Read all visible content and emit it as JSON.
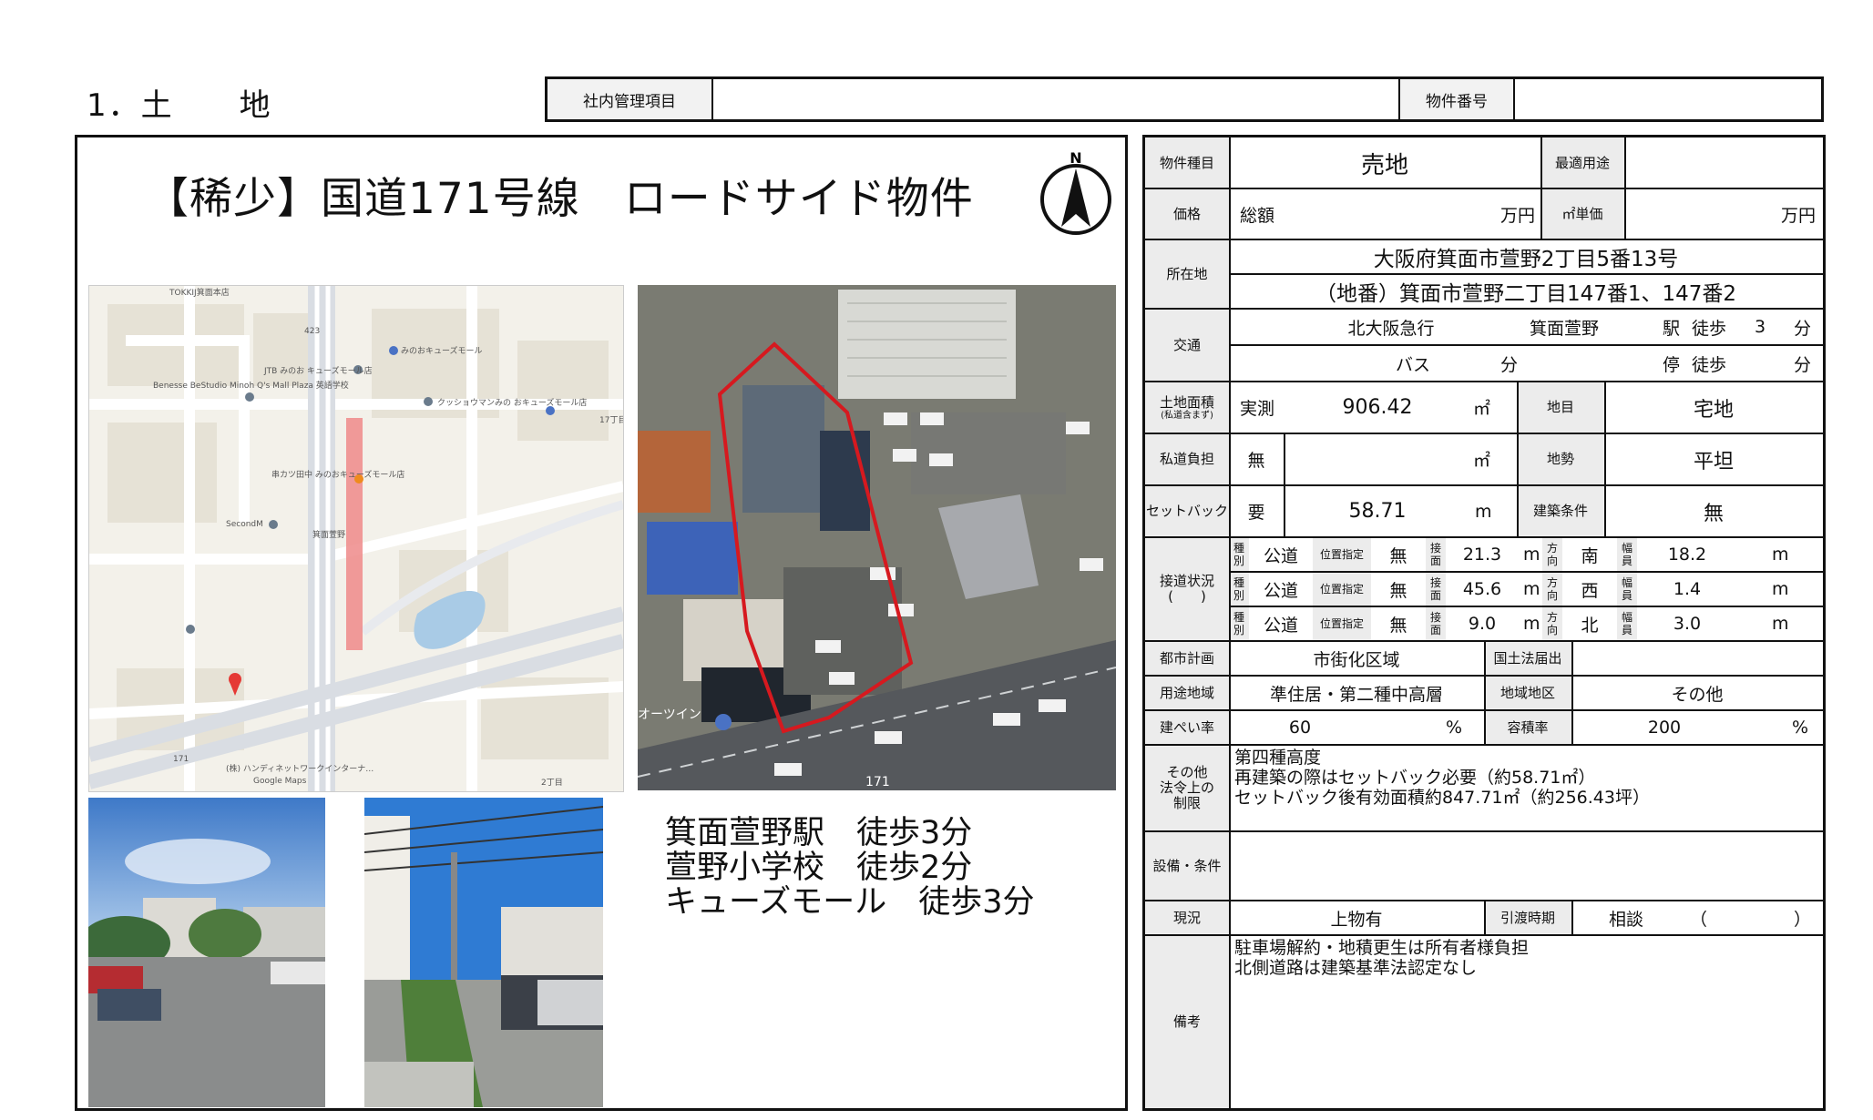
{
  "header": {
    "section_title": "1．土　　地",
    "mgmt_label": "社内管理項目",
    "mgmt_value": "",
    "property_no_label": "物件番号",
    "property_no_value": ""
  },
  "left": {
    "headline": "【稀少】国道171号線　ロードサイド物件",
    "compass_letter": "N",
    "map": {
      "labels": [
        "TOKKIJ箕面本店",
        "Benesse BeStudio Minoh Q's Mall Plaza 英語学校",
        "みのおキューズモール",
        "クッショウマンみの おキューズモール店",
        "JTB みのお キューズモール店",
        "串カツ田中 みのおキューズモール店",
        "SecondM",
        "箕面萱野",
        "17丁目",
        "2丁目",
        "(株) ハンディネットワークインターナ…",
        "Google Maps",
        "171",
        "423"
      ],
      "colors": {
        "bg": "#f3f1ea",
        "road": "#ffffff",
        "major": "#d9dde3",
        "block": "#e8e5dc",
        "highlight": "#ee8a8a",
        "water": "#a9cbe6"
      }
    },
    "aerial": {
      "labels": [
        "オーツイン",
        "171"
      ],
      "colors": {
        "ground": "#7a7b72",
        "road": "#55585c",
        "boundary": "#d6191f"
      }
    },
    "access": [
      "箕面萱野駅　徒歩3分",
      "萱野小学校　徒歩2分",
      "キューズモール　徒歩3分"
    ]
  },
  "table": {
    "type_label": "物件種目",
    "type_value": "売地",
    "best_use_label": "最適用途",
    "best_use_value": "",
    "price_label": "価格",
    "total_label": "総額",
    "man_yen": "万円",
    "unit_label": "㎡単価",
    "unit_man_yen": "万円",
    "location_label": "所在地",
    "address1": "大阪府箕面市萱野2丁目5番13号",
    "address2": "（地番）箕面市萱野二丁目147番1、147番2",
    "transport_label": "交通",
    "line": "北大阪急行",
    "station": "箕面萱野",
    "eki": "駅",
    "walk": "徒歩",
    "walk_min": "3",
    "fun": "分",
    "bus": "バス",
    "bus_fun": "分",
    "stop": "停",
    "walk2": "徒歩",
    "fun2": "分",
    "land_area_label": "土地面積",
    "land_area_sub": "(私道含まず)",
    "jissoku": "実測",
    "area_value": "906.42",
    "sqm": "㎡",
    "chimoku_label": "地目",
    "chimoku_value": "宅地",
    "private_road_label": "私道負担",
    "private_road_value": "無",
    "private_road_sqm": "㎡",
    "terrain_label": "地勢",
    "terrain_value": "平坦",
    "setback_label": "セットバック",
    "setback_req": "要",
    "setback_value": "58.71",
    "setback_unit": "m",
    "build_cond_label": "建築条件",
    "build_cond_value": "無",
    "road_label": "接道状況\n(　　)",
    "road_small": {
      "shubetsu": "種別",
      "ichi": "位置指定",
      "setsumen": "接面",
      "houkou": "方向",
      "fukuin": "幅員"
    },
    "roads": [
      {
        "kind": "公道",
        "designated": "無",
        "frontage": "21.3",
        "m1": "m",
        "direction": "南",
        "width": "18.2",
        "m2": "m"
      },
      {
        "kind": "公道",
        "designated": "無",
        "frontage": "45.6",
        "m1": "m",
        "direction": "西",
        "width": "1.4",
        "m2": "m"
      },
      {
        "kind": "公道",
        "designated": "無",
        "frontage": "9.0",
        "m1": "m",
        "direction": "北",
        "width": "3.0",
        "m2": "m"
      }
    ],
    "city_plan_label": "都市計画",
    "city_plan_value": "市街化区域",
    "kokudo_label": "国土法届出",
    "kokudo_value": "",
    "zoning_label": "用途地域",
    "zoning_value": "準住居・第二種中高層",
    "district_label": "地域地区",
    "district_value": "その他",
    "bcr_label": "建ぺい率",
    "bcr_value": "60",
    "pct": "%",
    "far_label": "容積率",
    "far_value": "200",
    "pct2": "%",
    "other_label": "その他\n法令上の\n制限",
    "other_text": "第四種高度\n再建築の際はセットバック必要（約58.71㎡）\nセットバック後有効面積約847.71㎡（約256.43坪）",
    "facility_label": "設備・条件",
    "facility_value": "",
    "status_label": "現況",
    "status_value": "上物有",
    "handover_label": "引渡時期",
    "handover_value": "相談",
    "paren_open": "（",
    "paren_close": "）",
    "remarks_label": "備考",
    "remarks_text": "駐車場解約・地積更生は所有者様負担\n北側道路は建築基準法認定なし"
  }
}
